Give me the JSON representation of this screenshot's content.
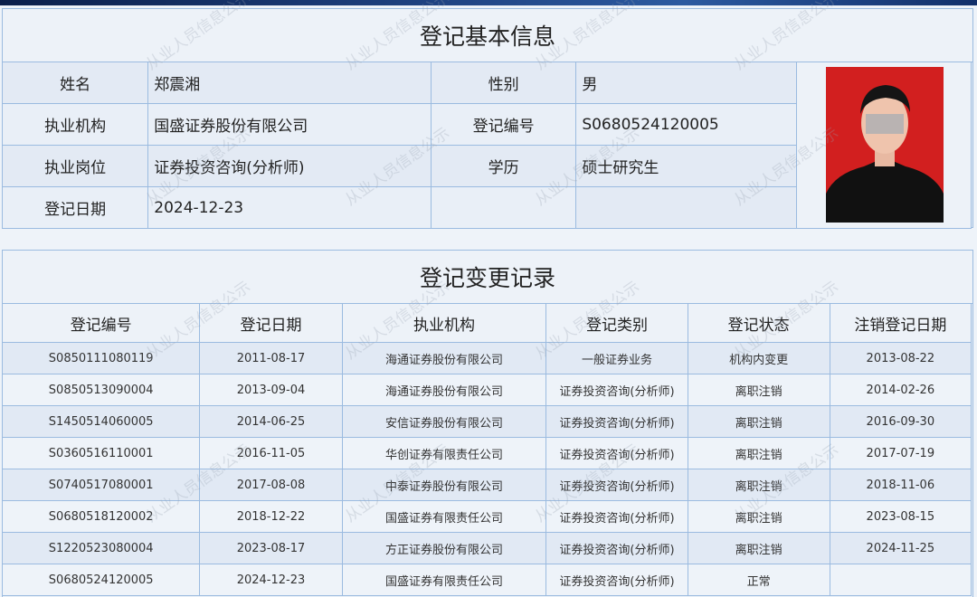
{
  "basic": {
    "title": "登记基本信息",
    "labels": {
      "name": "姓名",
      "gender": "性别",
      "org": "执业机构",
      "reg_no": "登记编号",
      "position": "执业岗位",
      "education": "学历",
      "reg_date": "登记日期"
    },
    "values": {
      "name": "郑震湘",
      "gender": "男",
      "org": "国盛证券股份有限公司",
      "reg_no": "S0680524120005",
      "position": "证券投资咨询(分析师)",
      "education": "硕士研究生",
      "reg_date": "2024-12-23"
    }
  },
  "changes": {
    "title": "登记变更记录",
    "headers": [
      "登记编号",
      "登记日期",
      "执业机构",
      "登记类别",
      "登记状态",
      "注销登记日期"
    ],
    "rows": [
      [
        "S0850111080119",
        "2011-08-17",
        "海通证券股份有限公司",
        "一般证券业务",
        "机构内变更",
        "2013-08-22"
      ],
      [
        "S0850513090004",
        "2013-09-04",
        "海通证券股份有限公司",
        "证券投资咨询(分析师)",
        "离职注销",
        "2014-02-26"
      ],
      [
        "S1450514060005",
        "2014-06-25",
        "安信证券股份有限公司",
        "证券投资咨询(分析师)",
        "离职注销",
        "2016-09-30"
      ],
      [
        "S0360516110001",
        "2016-11-05",
        "华创证券有限责任公司",
        "证券投资咨询(分析师)",
        "离职注销",
        "2017-07-19"
      ],
      [
        "S0740517080001",
        "2017-08-08",
        "中泰证券股份有限公司",
        "证券投资咨询(分析师)",
        "离职注销",
        "2018-11-06"
      ],
      [
        "S0680518120002",
        "2018-12-22",
        "国盛证券有限责任公司",
        "证券投资咨询(分析师)",
        "离职注销",
        "2023-08-15"
      ],
      [
        "S1220523080004",
        "2023-08-17",
        "方正证券股份有限公司",
        "证券投资咨询(分析师)",
        "离职注销",
        "2024-11-25"
      ],
      [
        "S0680524120005",
        "2024-12-23",
        "国盛证券有限责任公司",
        "证券投资咨询(分析师)",
        "正常",
        ""
      ]
    ]
  },
  "watermark": "从业人员信息公示",
  "colors": {
    "border": "#9bbbe0",
    "photo_bg": "#d21f1f",
    "row_alt": "#e1e9f4"
  }
}
